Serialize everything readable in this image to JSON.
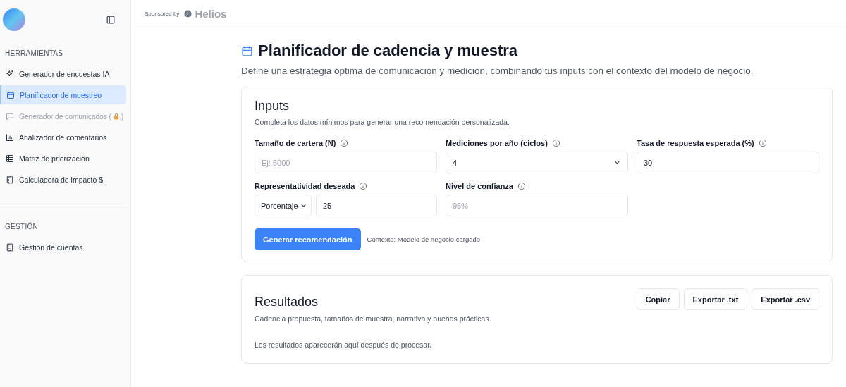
{
  "sidebar": {
    "sections": [
      {
        "title": "HERRAMIENTAS",
        "items": [
          {
            "label": "Generador de encuestas IA",
            "kind": "sparkles",
            "selected": false,
            "locked": false
          },
          {
            "label": "Planificador de muestreo",
            "kind": "calendar",
            "selected": true,
            "locked": false
          },
          {
            "label": "Generador de comunicados (",
            "after_lock": ")",
            "kind": "chat",
            "selected": false,
            "locked": true
          },
          {
            "label": "Analizador de comentarios",
            "kind": "chart",
            "selected": false,
            "locked": false
          },
          {
            "label": "Matriz de priorización",
            "kind": "grid",
            "selected": false,
            "locked": false
          },
          {
            "label": "Calculadora de impacto $",
            "kind": "calculator",
            "selected": false,
            "locked": false
          }
        ]
      },
      {
        "title": "GESTIÓN",
        "items": [
          {
            "label": "Gestión de cuentas",
            "kind": "building",
            "selected": false,
            "locked": false
          }
        ]
      }
    ]
  },
  "topbar": {
    "sponsor_label": "Sponsored by",
    "sponsor_name": "Helios"
  },
  "page": {
    "title": "Planificador de cadencia y muestra",
    "subtitle": "Define una estrategia óptima de comunicación y medición, combinando tus inputs con el contexto del modelo de negocio."
  },
  "inputs": {
    "title": "Inputs",
    "subtitle": "Completa los datos mínimos para generar una recomendación personalizada.",
    "fields": [
      {
        "kind": "text",
        "label": "Tamaño de cartera (N)",
        "placeholder": "Ej: 5000"
      },
      {
        "kind": "select",
        "label": "Mediciones por año (ciclos)",
        "value": "4"
      },
      {
        "kind": "text",
        "label": "Tasa de respuesta esperada (%)",
        "value": "30"
      },
      {
        "kind": "combo",
        "label": "Representatividad deseada",
        "unit": "Porcentaje",
        "value": "25"
      },
      {
        "kind": "text",
        "label": "Nivel de confianza",
        "placeholder": "95%"
      }
    ],
    "button": "Generar recomendación",
    "context": "Contexto: Modelo de negocio cargado"
  },
  "results": {
    "title": "Resultados",
    "subtitle": "Cadencia propuesta, tamaños de muestra, narrativa y buenas prácticas.",
    "empty": "Los resultados aparecerán aquí después de procesar.",
    "buttons": [
      "Copiar",
      "Exportar .txt",
      "Exportar .csv"
    ]
  }
}
